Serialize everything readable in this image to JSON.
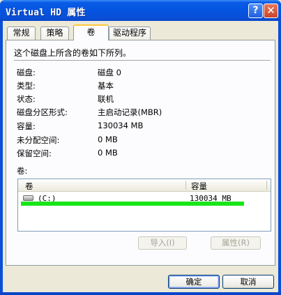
{
  "window": {
    "title": "Virtual HD 属性",
    "help_label": "?",
    "close_label": "✕"
  },
  "tabs": [
    {
      "label": "常规",
      "active": false
    },
    {
      "label": "策略",
      "active": false
    },
    {
      "label": "卷",
      "active": true
    },
    {
      "label": "驱动程序",
      "active": false
    }
  ],
  "volume_tab": {
    "description": "这个磁盘上所含的卷如下所列。",
    "fields": [
      {
        "label": "磁盘:",
        "value": "磁盘 0"
      },
      {
        "label": "类型:",
        "value": "基本"
      },
      {
        "label": "状态:",
        "value": "联机"
      },
      {
        "label": "磁盘分区形式:",
        "value": "主启动记录(MBR)"
      },
      {
        "label": "容量:",
        "value": "130034 MB"
      },
      {
        "label": "未分配空间:",
        "value": "0 MB"
      },
      {
        "label": "保留空间:",
        "value": "0 MB"
      }
    ],
    "volumes_label": "卷:",
    "list": {
      "columns": [
        "卷",
        "容量"
      ],
      "rows": [
        {
          "icon": "drive-icon",
          "name": "(C:)",
          "capacity": "130034 MB"
        }
      ]
    },
    "import_button": "导入(I)",
    "properties_button": "属性(R)"
  },
  "footer": {
    "ok_label": "确定",
    "cancel_label": "取消"
  },
  "colors": {
    "titlebar": "#0a4fd8",
    "highlight_bar": "#19e619",
    "active_tab_accent": "#ffc73c"
  }
}
